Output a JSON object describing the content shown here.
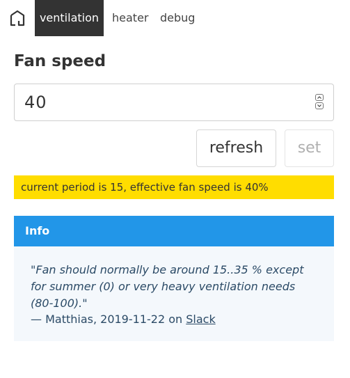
{
  "nav": {
    "tabs": [
      {
        "label": "ventilation",
        "active": true
      },
      {
        "label": "heater",
        "active": false
      },
      {
        "label": "debug",
        "active": false
      }
    ],
    "logo_icon": "house-icon"
  },
  "fan": {
    "title": "Fan speed",
    "value": "40"
  },
  "buttons": {
    "refresh": "refresh",
    "set": "set"
  },
  "status": {
    "text": "current period is 15, effective fan speed is 40%",
    "color": "#ffdd00"
  },
  "info": {
    "header": "Info",
    "header_color": "#2296e8",
    "quote": "\"Fan should normally be around 15..35 % except for summer (0) or very heavy ventilation needs (80-100).\"",
    "attribution_prefix": "— Matthias, 2019-11-22 on ",
    "attribution_link": "Slack"
  }
}
